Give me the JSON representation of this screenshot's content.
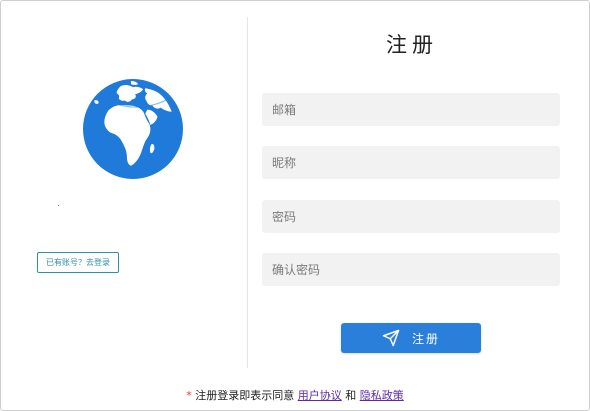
{
  "title": "注册",
  "left": {
    "icon": "globe-icon",
    "login_link": "已有账号？去登录"
  },
  "form": {
    "email_placeholder": "邮箱",
    "nickname_placeholder": "昵称",
    "password_placeholder": "密码",
    "confirm_placeholder": "确认密码",
    "submit_label": "注册",
    "submit_icon": "send-icon"
  },
  "agreement": {
    "asterisk": "*",
    "prefix": "注册登录即表示同意",
    "user_agreement": "用户协议",
    "and": "和",
    "privacy_policy": "隐私政策"
  },
  "colors": {
    "accent": "#2a7fda",
    "globe": "#1f7ad9",
    "link": "#5b2aa6",
    "login_link": "#2f8fa3",
    "field_bg": "#f2f2f2"
  }
}
